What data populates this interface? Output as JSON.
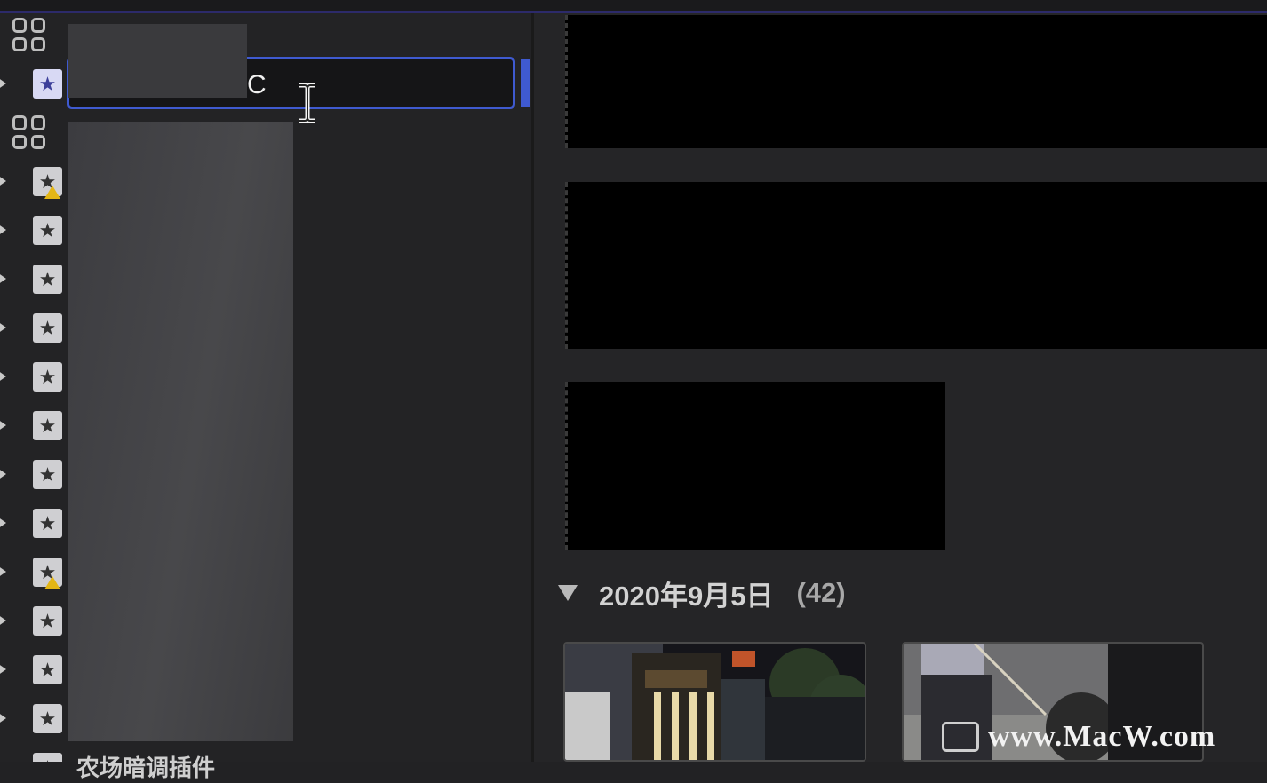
{
  "rename": {
    "visible_text": "C"
  },
  "sidebar": {
    "bottom_label": "农场暗调插件"
  },
  "section": {
    "date": "2020年9月5日",
    "count": "(42)"
  },
  "watermark": {
    "text": "www.MacW.com"
  },
  "icons": {
    "library_icon": "grid-icon",
    "event_icon": "star-icon",
    "warning_icon": "warning-icon",
    "disclosure_icon": "triangle-right-icon",
    "cursor": "i-beam-cursor"
  },
  "colors": {
    "selection_blue": "#3f5ad0",
    "warning_yellow": "#e3b615",
    "background": "#232325"
  }
}
